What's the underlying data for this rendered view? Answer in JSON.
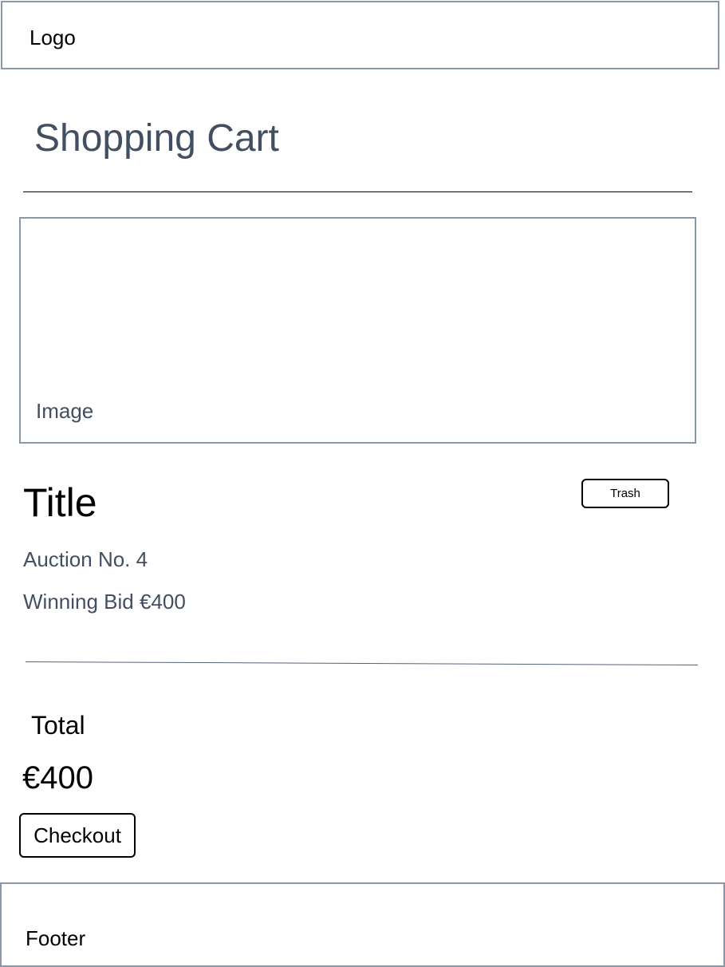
{
  "header": {
    "logo": "Logo"
  },
  "page": {
    "title": "Shopping Cart"
  },
  "cart_item": {
    "image_label": "Image",
    "title": "Title",
    "trash_label": "Trash",
    "auction_no": "Auction No. 4",
    "winning_bid": "Winning Bid €400"
  },
  "summary": {
    "total_label": "Total",
    "total_value": "€400",
    "checkout_label": "Checkout"
  },
  "footer": {
    "label": "Footer"
  },
  "colors": {
    "border": "#8a97a8",
    "muted_text": "#424f61",
    "text": "#000000",
    "background": "#ffffff"
  }
}
